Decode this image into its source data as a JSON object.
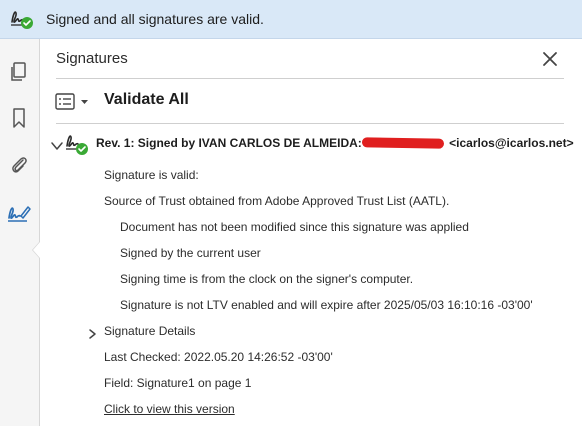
{
  "banner": {
    "status_text": "Signed and all signatures are valid."
  },
  "sidebar": {
    "items": [
      {
        "icon": "pages-icon"
      },
      {
        "icon": "bookmark-icon"
      },
      {
        "icon": "attachment-icon"
      },
      {
        "icon": "signature-icon",
        "active": true
      }
    ]
  },
  "panel": {
    "title": "Signatures",
    "validate_all_label": "Validate All",
    "revision": {
      "label_prefix": "Rev. 1: Signed by IVAN CARLOS DE ALMEIDA:",
      "label_suffix": "<icarlos@icarlos.net>",
      "status": "Signature is valid:",
      "trust": "Source of Trust obtained from Adobe Approved Trust List (AATL).",
      "checks": [
        "Document has not been modified since this signature was applied",
        "Signed by the current user",
        "Signing time is from the clock on the signer's computer.",
        "Signature is not LTV enabled and will expire after 2025/05/03 16:10:16 -03'00'"
      ],
      "details_label": "Signature Details",
      "last_checked": "Last Checked: 2022.05.20 14:26:52 -03'00'",
      "field": "Field: Signature1 on page 1",
      "view_version_link": "Click to view this version"
    }
  },
  "colors": {
    "banner_bg": "#d9e8f7",
    "valid_green": "#3aa935",
    "icon_blue": "#2c6fb5",
    "redaction": "#e01f1f"
  }
}
